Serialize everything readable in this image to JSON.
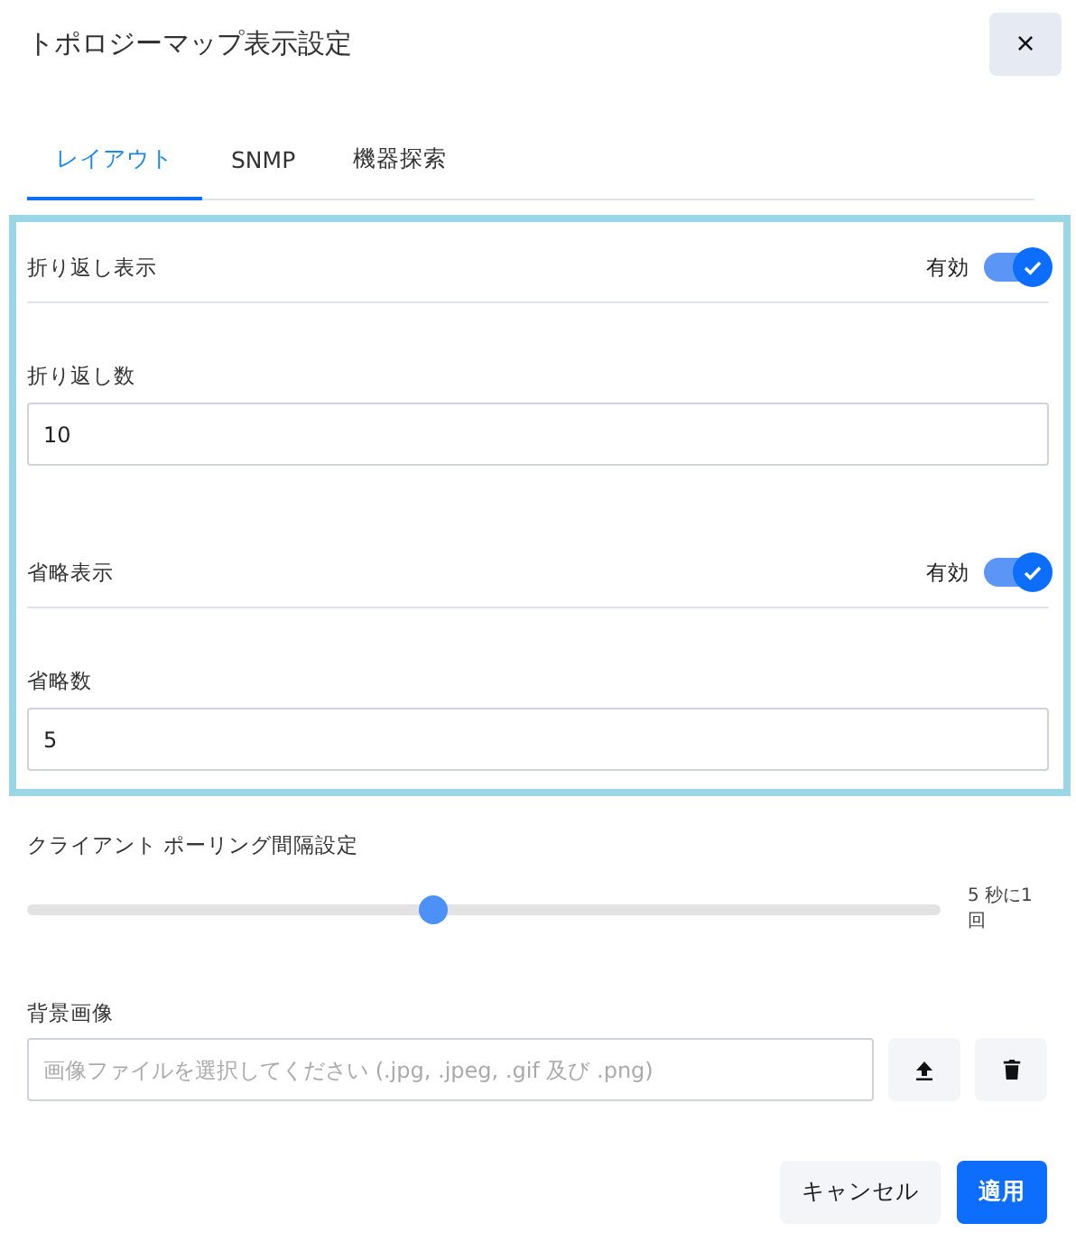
{
  "dialog": {
    "title": "トポロジーマップ表示設定",
    "close": "×"
  },
  "tabs": [
    {
      "label": "レイアウト",
      "selected": true
    },
    {
      "label": "SNMP",
      "selected": false
    },
    {
      "label": "機器探索",
      "selected": false
    }
  ],
  "layout_settings": [
    {
      "kind": "toggle",
      "label": "折り返し表示",
      "state_label": "有効",
      "on": true
    },
    {
      "kind": "number",
      "label": "折り返し数",
      "value": "10"
    },
    {
      "kind": "toggle",
      "label": "省略表示",
      "state_label": "有効",
      "on": true
    },
    {
      "kind": "number",
      "label": "省略数",
      "value": "5"
    }
  ],
  "polling": {
    "label": "クライアント ポーリング間隔設定",
    "level": 0.445,
    "reading": "5 秒に1回"
  },
  "background_image": {
    "label": "背景画像",
    "placeholder": "画像ファイルを選択してください (.jpg, .jpeg, .gif 及び .png)"
  },
  "buttons": [
    {
      "label": "キャンセル",
      "kind": "secondary"
    },
    {
      "label": "適用",
      "kind": "primary"
    }
  ]
}
